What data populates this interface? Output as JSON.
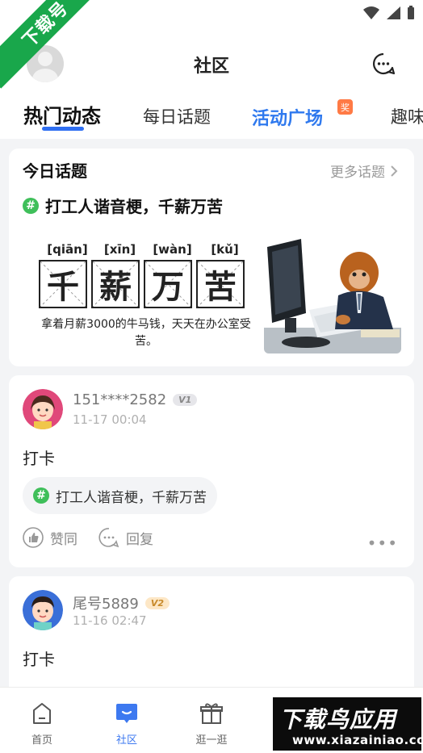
{
  "watermark": {
    "corner_text": "下载号"
  },
  "header": {
    "title": "社区"
  },
  "tabs": [
    {
      "label": "热门动态"
    },
    {
      "label": "每日话题"
    },
    {
      "label": "活动广场"
    },
    {
      "label": "趣味"
    }
  ],
  "award_badge": "奖",
  "topic_card": {
    "title": "今日话题",
    "more_label": "更多话题",
    "headline": "打工人谐音梗，千薪万苦",
    "pinyin": [
      "[qiān]",
      "[xīn]",
      "[wàn]",
      "[kǔ]"
    ],
    "characters": [
      "千",
      "薪",
      "万",
      "苦"
    ],
    "caption": "拿着月薪3000的牛马钱，天天在办公室受苦。"
  },
  "posts": [
    {
      "username": "151****2582",
      "level": "V1",
      "time": "11-17 00:04",
      "text": "打卡",
      "tag": "打工人谐音梗，千薪万苦",
      "like_label": "赞同",
      "reply_label": "回复"
    },
    {
      "username": "尾号5889",
      "level": "V2",
      "time": "11-16 02:47",
      "text": "打卡"
    }
  ],
  "bottom_nav": [
    {
      "label": "首页"
    },
    {
      "label": "社区"
    },
    {
      "label": "逛一逛"
    }
  ],
  "ad": {
    "main_text": "下载鸟应用",
    "url": "www.xiazainiao.com"
  },
  "colors": {
    "accent": "#2f6ff2",
    "hashtag": "#3fbf5a",
    "watermark": "#19a74b"
  }
}
